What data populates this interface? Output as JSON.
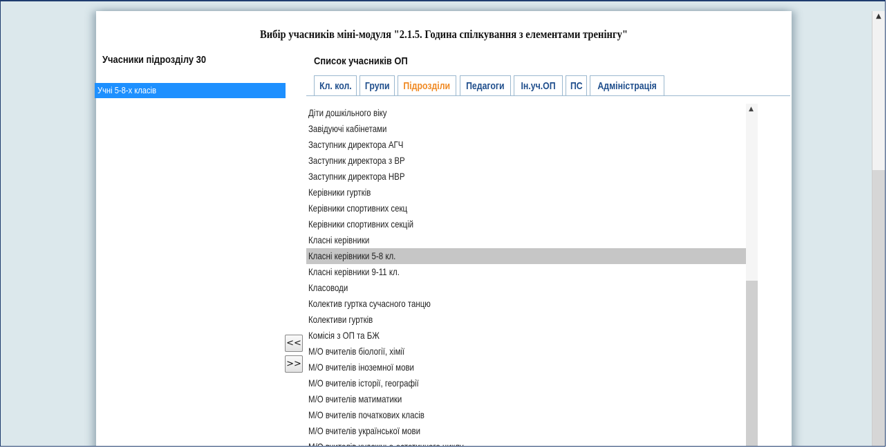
{
  "title": "Вибір учасників міні-модуля \"2.1.5. Година спілкування з елементами тренінгу\"",
  "left_panel": {
    "header": "Учасники підрозділу 30",
    "items": [
      "Учні 5-8-х класів"
    ]
  },
  "right_panel": {
    "header": "Список учасників ОП",
    "tabs": [
      "Кл. кол.",
      "Групи",
      "Підрозділи",
      "Педагоги",
      "Ін.уч.ОП",
      "ПС",
      "Адміністрація"
    ],
    "active_tab": "Підрозділи",
    "list": [
      "Діти дошкільного віку",
      "Завідуючі кабінетами",
      "Заступник директора АГЧ",
      "Заступник директора з ВР",
      "Заступник директора НВР",
      "Керівники гуртків",
      "Керівники спортивних секц",
      "Керівники спортивних секцій",
      "Класні керівники",
      "Класні керівники 5-8 кл.",
      "Класні керівники 9-11 кл.",
      "Класоводи",
      "Колектив гуртка сучасного танцю",
      "Колективи гуртків",
      "Комісія з ОП та БЖ",
      "М/О вчителів біології, хімії",
      "М/О вчителів іноземної мови",
      "М/О вчителів історії, географії",
      "М/О вчителів матиматики",
      "М/О вчителів початкових класів",
      "М/О вчителів української мови",
      "М/О вчителів художньо-естетичного циклу"
    ],
    "selected_item": "Класні керівники 5-8 кл."
  },
  "buttons": {
    "move_left": "<<",
    "move_right": ">>"
  },
  "icons": {
    "scroll_up": "scroll-up-arrow-icon"
  },
  "colors": {
    "selection_blue": "#1e90ff",
    "active_tab": "#f08a24",
    "tab_text": "#1f4e8c",
    "row_selected": "#c6c6c6"
  }
}
